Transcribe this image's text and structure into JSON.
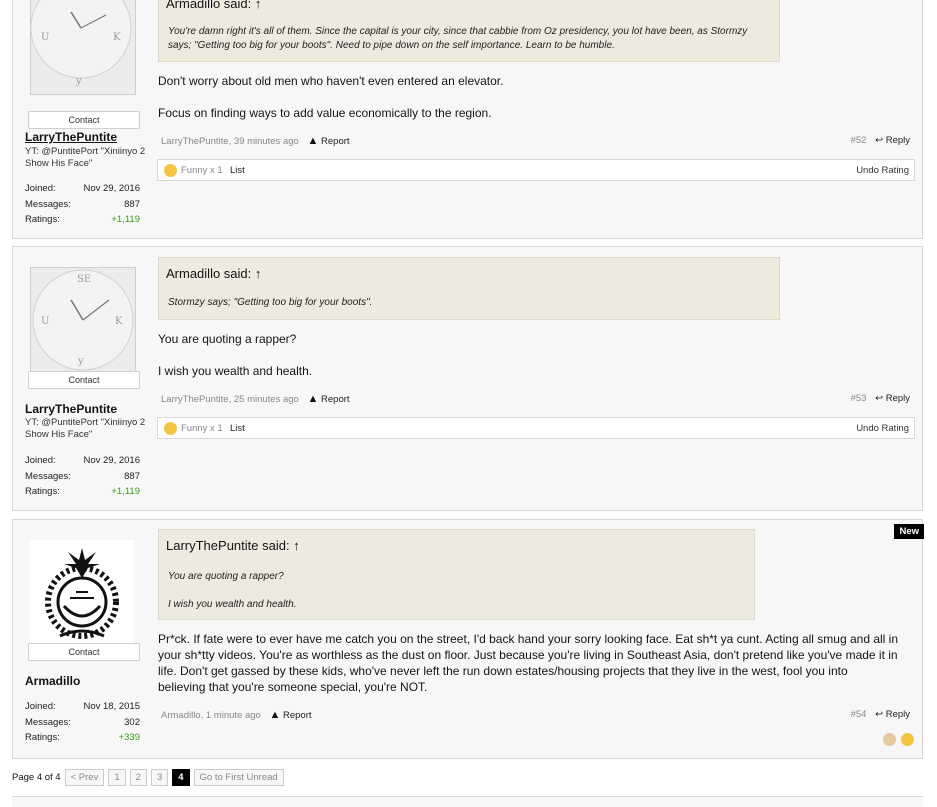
{
  "posts": [
    {
      "id": "p52",
      "user": {
        "name": "LarryThePuntite",
        "title": "YT: @PuntitePort \"Xiniinyo 2 Show His Face\"",
        "contact": "Contact",
        "stats": [
          {
            "label": "Joined:",
            "value": "Nov 29, 2016"
          },
          {
            "label": "Messages:",
            "value": "887"
          },
          {
            "label": "Ratings:",
            "value": "+1,119"
          }
        ]
      },
      "quote": {
        "head": "Armadillo said: ↑",
        "text": "You're damn right it's all of them. Since the capital is your city, since that cabbie from Oz presidency, you lot have been, as Stormzy says; \"Getting too big for your boots\". Need to pipe down on the self importance. Learn to be humble."
      },
      "message": [
        "Don't worry about old men who haven't even entered an elevator.",
        "Focus on finding ways to add value economically to the region."
      ],
      "meta": {
        "author_time": "LarryThePuntite, 39 minutes ago",
        "report": "Report",
        "number": "#52",
        "reply": "Reply"
      },
      "ratings": {
        "funny": "Funny x 1",
        "list": "List",
        "undo": "Undo Rating"
      }
    },
    {
      "id": "p53",
      "user": {
        "name": "LarryThePuntite",
        "title": "YT: @PuntitePort \"Xiniinyo 2 Show His Face\"",
        "contact": "Contact",
        "stats": [
          {
            "label": "Joined:",
            "value": "Nov 29, 2016"
          },
          {
            "label": "Messages:",
            "value": "887"
          },
          {
            "label": "Ratings:",
            "value": "+1,119"
          }
        ]
      },
      "quote": {
        "head": "Armadillo said: ↑",
        "text": "Stormzy says; \"Getting too big for your boots\"."
      },
      "message": [
        "You are quoting a rapper?",
        "I wish you wealth and health."
      ],
      "meta": {
        "author_time": "LarryThePuntite, 25 minutes ago",
        "report": "Report",
        "number": "#53",
        "reply": "Reply"
      },
      "ratings": {
        "funny": "Funny x 1",
        "list": "List",
        "undo": "Undo Rating"
      }
    },
    {
      "id": "p54",
      "badge": "New",
      "user": {
        "name": "Armadillo",
        "contact": "Contact",
        "stats": [
          {
            "label": "Joined:",
            "value": "Nov 18, 2015"
          },
          {
            "label": "Messages:",
            "value": "302"
          },
          {
            "label": "Ratings:",
            "value": "+339"
          }
        ]
      },
      "quote": {
        "head": "LarryThePuntite said: ↑",
        "line1": "You are quoting a rapper?",
        "line2": "I wish you wealth and health."
      },
      "message": [
        "Pr*ck. If fate were to ever have me catch you on the street, I'd back hand your sorry looking face. Eat sh*t ya cunt. Acting all smug and all in your sh*tty videos. You're as worthless as the dust on floor. Just because you're living in Southeast Asia, don't pretend like you've made it in life. Don't get gassed by these kids, who've never left the run down estates/housing projects that they live in the west, fool you into believing that you're someone special, you're NOT."
      ],
      "meta": {
        "author_time": "Armadillo, 1 minute ago",
        "report": "Report",
        "number": "#54",
        "reply": "Reply"
      }
    }
  ],
  "pagenav": {
    "label": "Page 4 of 4",
    "prev": "< Prev",
    "pages": [
      "1",
      "2",
      "3",
      "4"
    ],
    "current": "4",
    "first_unread": "Go to First Unread"
  },
  "colors": {
    "post_bg": "#f7f7f7",
    "quote_bg": "#ecebdd",
    "positive": "#3b9a1a"
  },
  "icons": {
    "avatar1": "clock-avatar",
    "avatar2": "emblem-avatar",
    "report": "warning-icon",
    "reply": "reply-arrow-icon",
    "funny": "funny-emoji-icon"
  }
}
